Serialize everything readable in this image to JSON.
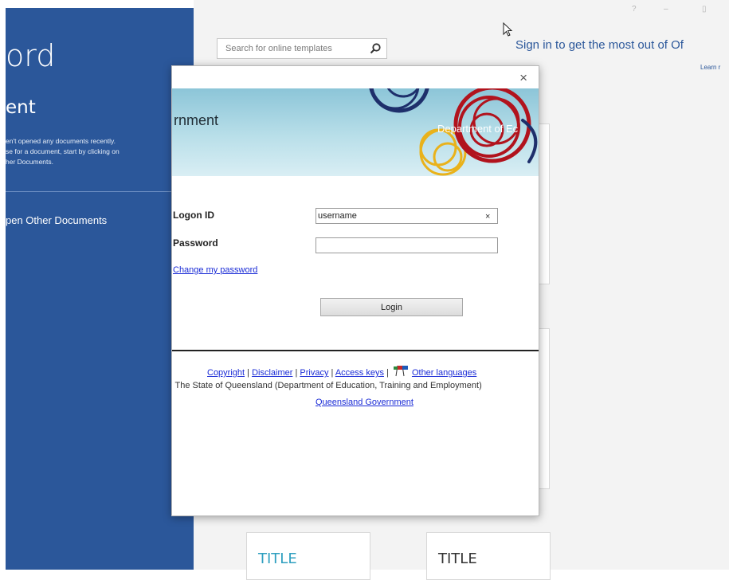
{
  "left_panel": {
    "app_title": "ord",
    "recent_heading": "ent",
    "recent_description_lines": [
      "en't opened any documents recently.",
      "se for a document, start by clicking on",
      "her Documents."
    ],
    "open_other": "pen Other Documents"
  },
  "window_controls": {
    "help": "?",
    "minimize": "–",
    "restore": "▯"
  },
  "search": {
    "placeholder": "Search for online templates"
  },
  "signin": {
    "text": "Sign in to get the most out of Of",
    "learn": "Learn r"
  },
  "templates": [
    {
      "title": "TITLE",
      "color": "#2e9fbf"
    },
    {
      "title": "TITLE",
      "color": "#333333"
    }
  ],
  "dialog": {
    "close": "×",
    "banner_title": "rnment",
    "banner_dept": "Department of Ec",
    "logon_label": "Logon ID",
    "logon_value": "username",
    "clear_glyph": "×",
    "password_label": "Password",
    "password_value": "",
    "change_password": "Change my password",
    "login_button": "Login",
    "footer": {
      "copyright": "Copyright",
      "disclaimer": "Disclaimer",
      "privacy": "Privacy",
      "access_keys": "Access keys",
      "other_languages": "Other languages",
      "sep": " | ",
      "state_line": ") The State of Queensland (Department of Education, Training and Employment)",
      "qld_gov": "Queensland Government"
    }
  },
  "colors": {
    "word_blue": "#2b579a",
    "link_blue": "#1a2bd6",
    "banner": "#8cc5d8"
  }
}
